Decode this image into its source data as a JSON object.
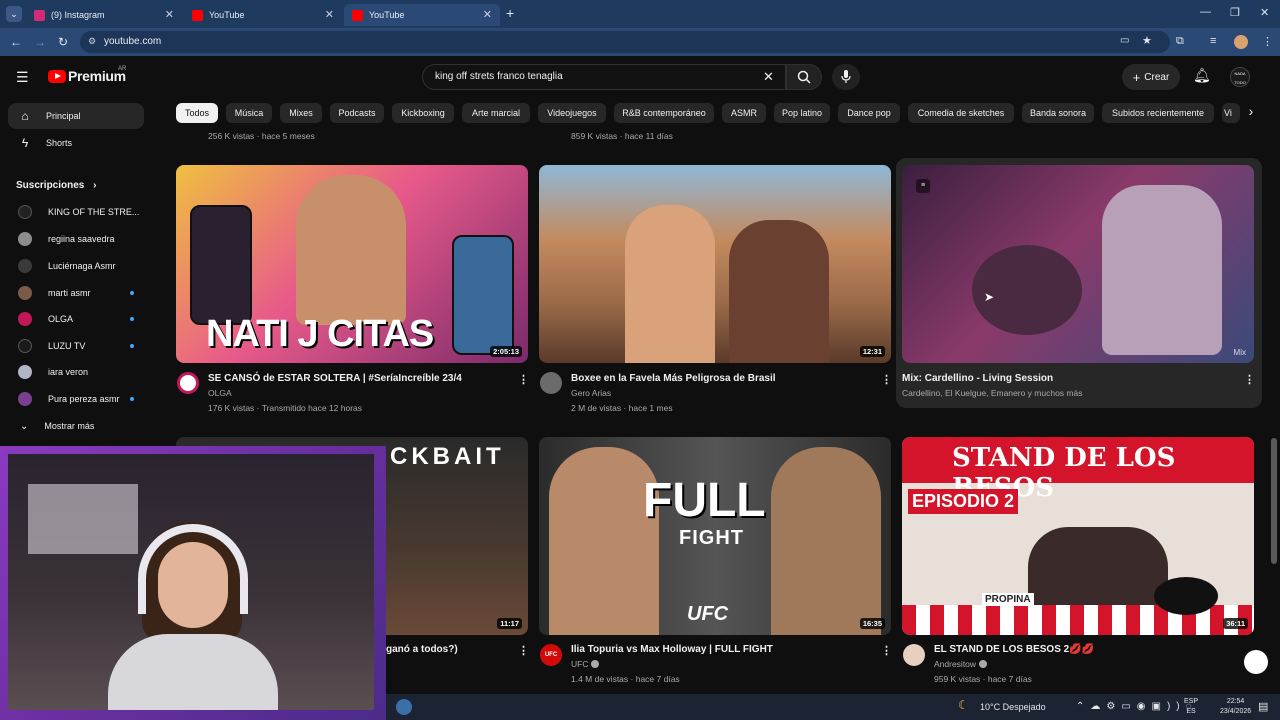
{
  "browser": {
    "tabs": [
      {
        "label": "(9) Instagram",
        "icon": "instagram-icon",
        "color": "#d62976"
      },
      {
        "label": "YouTube",
        "icon": "youtube-icon",
        "color": "#ff0000"
      },
      {
        "label": "YouTube",
        "icon": "youtube-icon",
        "color": "#ff0000"
      }
    ],
    "url": "youtube.com"
  },
  "header": {
    "logo": "Premium",
    "region": "AR",
    "search_value": "king off strets franco tenaglia",
    "create_label": "Crear",
    "avatar_label": "NADA TODO"
  },
  "sidebar": {
    "items": [
      {
        "label": "Principal",
        "icon": "home-icon"
      },
      {
        "label": "Shorts",
        "icon": "shorts-icon"
      }
    ],
    "subs_title": "Suscripciones",
    "subs": [
      {
        "label": "KING OF THE STRE...",
        "color": "#222"
      },
      {
        "label": "regiina saavedra",
        "color": "#8d8d8d"
      },
      {
        "label": "Luciérnaga Asmr",
        "color": "#2a2a2a"
      },
      {
        "label": "marti asmr",
        "color": "#7b5a4a"
      },
      {
        "label": "OLGA",
        "color": "#c2185b"
      },
      {
        "label": "LUZU TV",
        "color": "#1b1b1b"
      },
      {
        "label": "iara veron",
        "color": "#b0b6c3"
      },
      {
        "label": "Pura pereza asmr",
        "color": "#7a3f8f"
      }
    ],
    "show_more": "Mostrar más"
  },
  "chips": [
    "Todos",
    "Música",
    "Mixes",
    "Podcasts",
    "Kickboxing",
    "Arte marcial",
    "Videojuegos",
    "R&B contemporáneo",
    "ASMR",
    "Pop latino",
    "Dance pop",
    "Comedia de sketches",
    "Banda sonora",
    "Subidos recientemente",
    "Vi"
  ],
  "top_meta": [
    "256 K vistas · hace 5 meses",
    "859 K vistas · hace 11 días"
  ],
  "videos_row1": [
    {
      "title": "SE CANSÓ de ESTAR SOLTERA | #SeríaIncreíble 23/4",
      "channel": "OLGA",
      "meta": "176 K vistas · Transmitido hace 12 horas",
      "duration": "2:05:13",
      "thumb_text": "NATI J CITAS"
    },
    {
      "title": "Boxee en la Favela Más Peligrosa de Brasil",
      "channel": "Gero Arias",
      "meta": "2 M de vistas · hace 1 mes",
      "duration": "12:31"
    },
    {
      "title": "Mix: Cardellino - Living Session",
      "channel": "Cardellino, El Kuelgue, Emanero y muchos más",
      "duration": "Mix"
    }
  ],
  "videos_row2": [
    {
      "title": "ganó a todos?)",
      "duration": "11:17",
      "thumb_text": "CKBAIT"
    },
    {
      "title": "Ilia Topuria vs Max Holloway | FULL FIGHT",
      "channel": "UFC",
      "meta": "1.4 M de vistas · hace 7 días",
      "duration": "16:35",
      "thumb_text": "FULL",
      "thumb_text2": "FIGHT",
      "thumb_text3": "UFC"
    },
    {
      "title": "EL STAND DE LOS BESOS 2💋💋",
      "channel": "Andresitow",
      "meta": "959 K vistas · hace 7 días",
      "duration": "36:11",
      "thumb_text": "STAND DE LOS BESOS",
      "thumb_text2": "EPISODIO 2",
      "thumb_text3": "PROPINA"
    }
  ],
  "taskbar": {
    "weather": "10°C  Despejado",
    "lang1": "ESP",
    "lang2": "ES",
    "time": "22:54",
    "date": "23/4/2026"
  }
}
